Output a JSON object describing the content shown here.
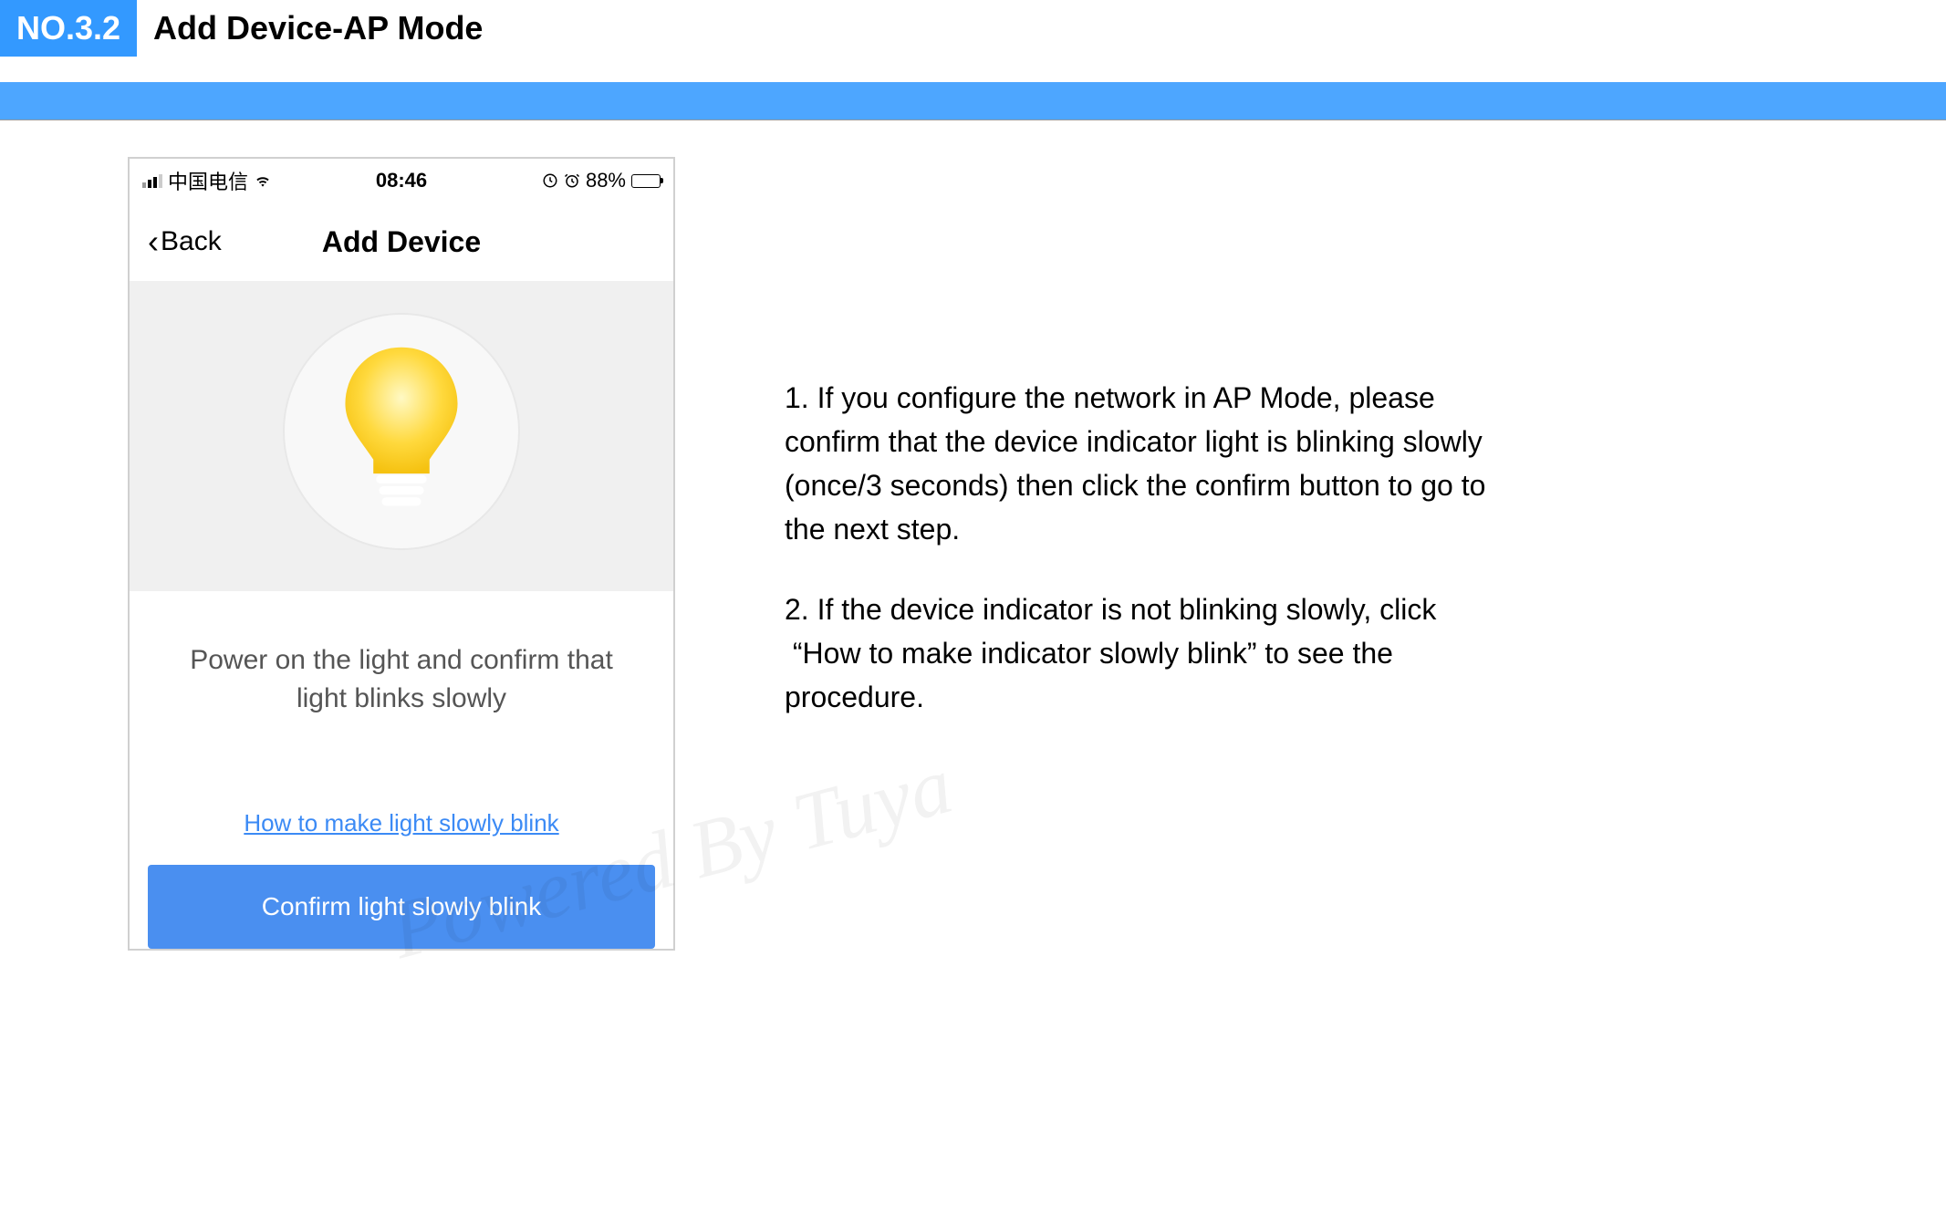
{
  "header": {
    "section_number": "NO.3.2",
    "section_title": "Add Device-AP Mode"
  },
  "phone": {
    "status_bar": {
      "carrier": "中国电信",
      "time": "08:46",
      "battery_text": "88%"
    },
    "nav": {
      "back_label": "Back",
      "title": "Add Device"
    },
    "instruction": "Power on the light and confirm that light blinks slowly",
    "help_link": "How to make light slowly blink",
    "confirm_button": "Confirm light slowly blink"
  },
  "description": {
    "para1": "1. If you configure the network in AP Mode, please confirm that the device indicator light is blinking slowly (once/3 seconds) then click the confirm button to go to the next step.",
    "para2": "2. If the device indicator is not blinking slowly, click  “How to make indicator slowly blink” to see the procedure."
  },
  "watermark": "Powered By Tuya"
}
